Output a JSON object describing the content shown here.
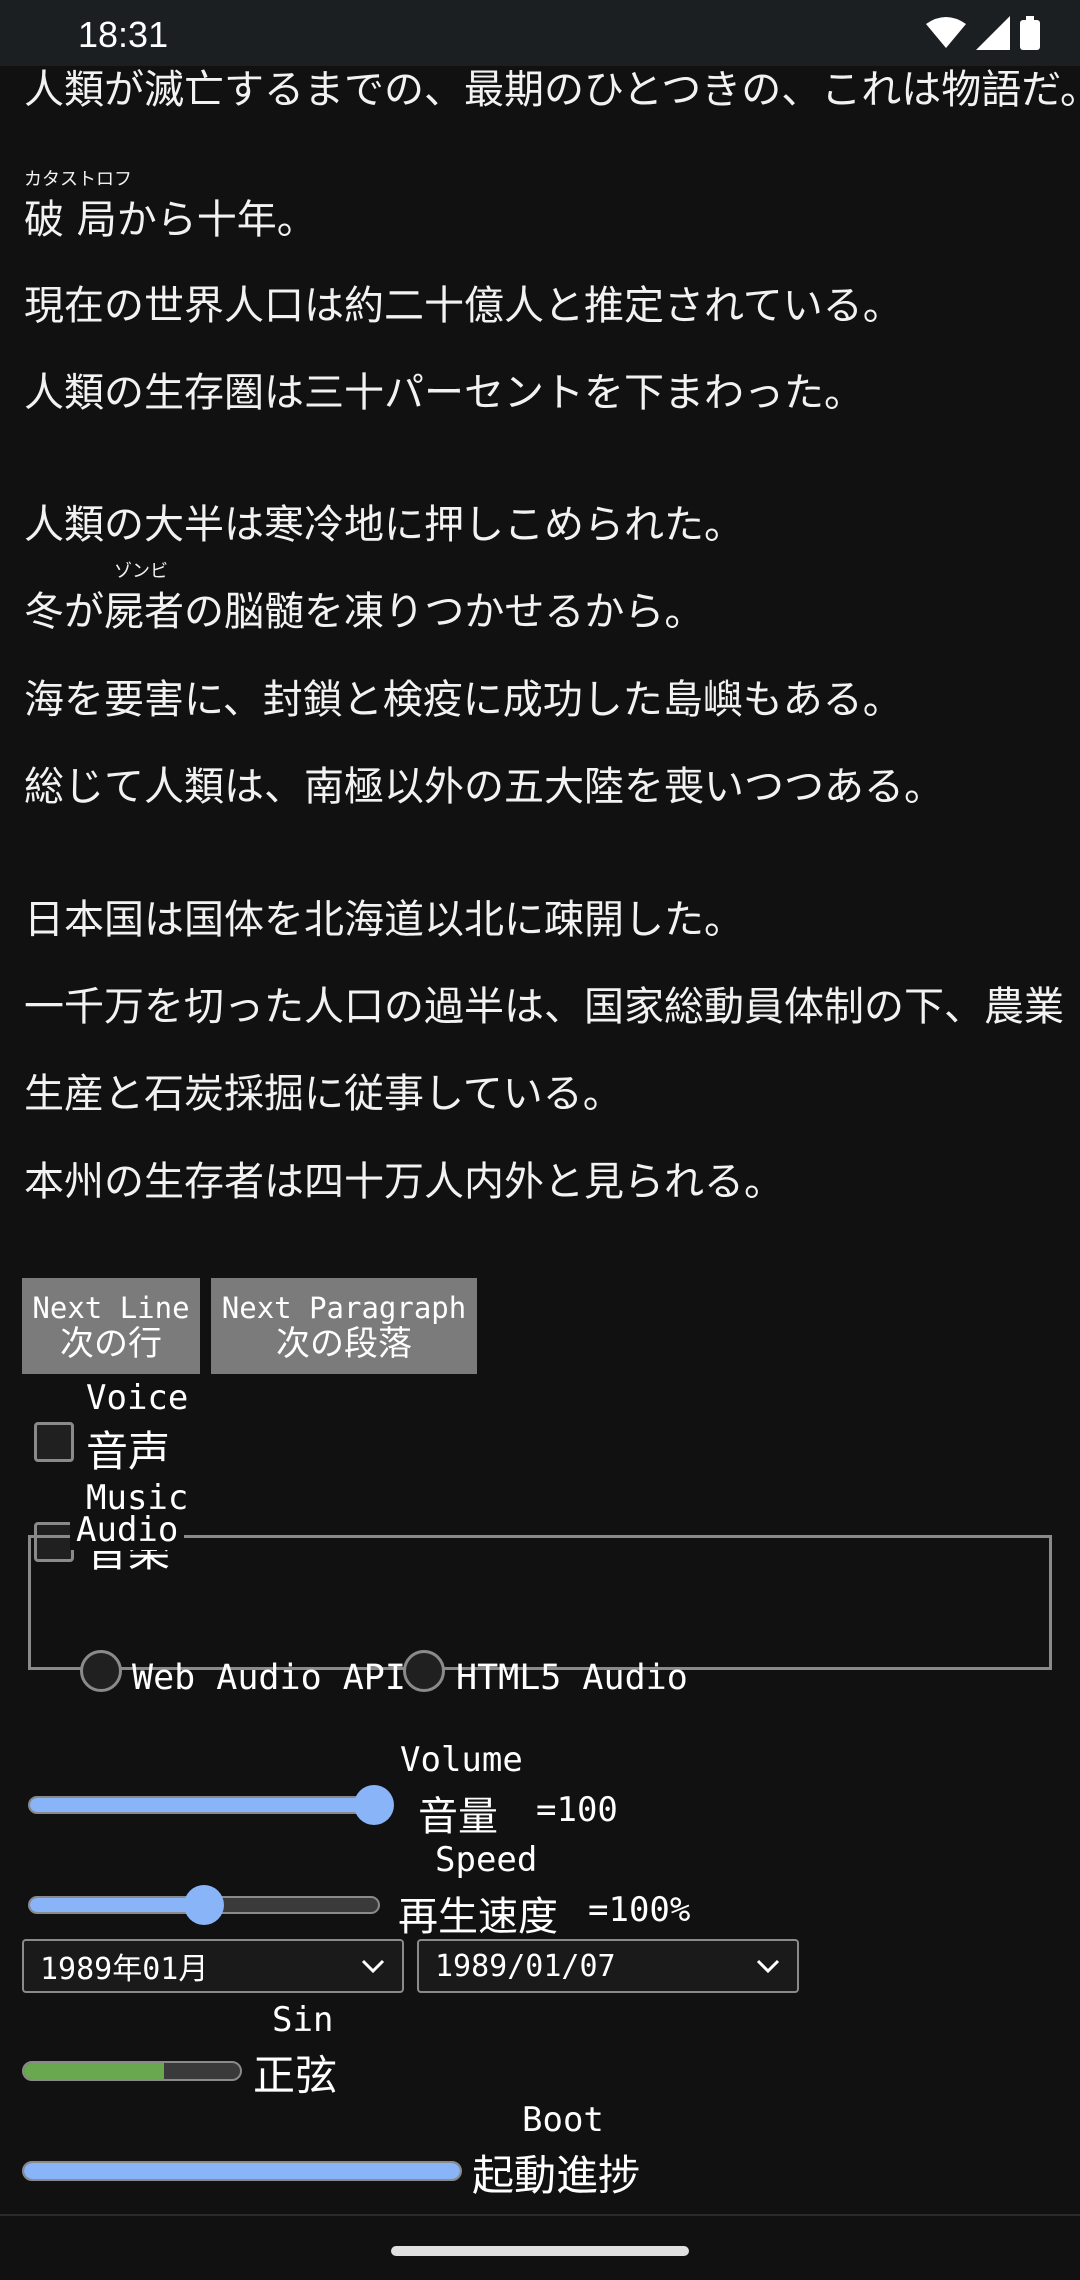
{
  "status_bar": {
    "time": "18:31"
  },
  "text_lines": [
    "人類が滅亡するまでの、最期のひとつきの、これは物語だ。",
    "局から十年。",
    "現在の世界人口は約二十億人と推定されている。",
    "人類の生存圏は三十パーセントを下まわった。",
    "人類の大半は寒冷地に押しこめられた。",
    "冬が",
    "の脳髄を凍りつかせるから。",
    "海を要害に、封鎖と検疫に成功した島嶼もある。",
    "総じて人類は、南極以外の五大陸を喪いつつある。",
    "日本国は国体を北海道以北に疎開した。",
    "一千万を切った人口の過半は、国家総動員体制の下、農業",
    "生産と石炭採掘に従事している。",
    "本州の生存者は四十万人内外と見られる。"
  ],
  "ruby": {
    "catastrophe_base": "破",
    "catastrophe_reading": "カタストロフ",
    "zombie_base": "屍者",
    "zombie_reading": "ゾンビ"
  },
  "buttons": {
    "next_line_en": "Next Line",
    "next_line_ja": "次の行",
    "next_paragraph_en": "Next Paragraph",
    "next_paragraph_ja": "次の段落"
  },
  "checkboxes": {
    "voice_en": "Voice",
    "voice_ja": "音声",
    "voice_checked": false,
    "music_en": "Music",
    "music_ja": "音楽",
    "music_checked": false
  },
  "audio": {
    "legend": "Audio",
    "options": [
      "Web Audio API",
      "HTML5 Audio"
    ]
  },
  "volume": {
    "label_en": "Volume",
    "label_ja": "音量",
    "value_text": "=100",
    "value": 100
  },
  "speed": {
    "label_en": "Speed",
    "label_ja": "再生速度",
    "value_text": "=100%",
    "value": 0.5
  },
  "selects": {
    "month": "1989年01月",
    "date": "1989/01/07"
  },
  "sin": {
    "label_en": "Sin",
    "label_ja": "正弦",
    "value": 0.65,
    "color": "#6aa84f"
  },
  "boot": {
    "label_en": "Boot",
    "label_ja": "起動進捗",
    "value": 1.0,
    "color": "#8ab4f8"
  }
}
